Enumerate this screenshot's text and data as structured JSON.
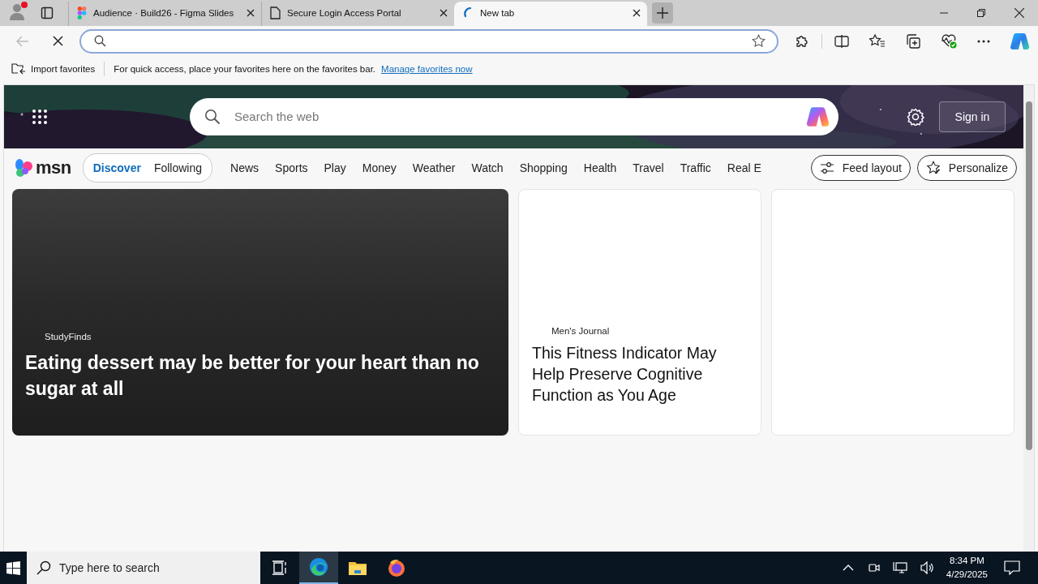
{
  "tabs": [
    {
      "title": "Audience · Build26 - Figma Slides",
      "selected": false
    },
    {
      "title": "Secure Login Access Portal",
      "selected": false
    },
    {
      "title": "New tab",
      "selected": true
    }
  ],
  "favorites_bar": {
    "import": "Import favorites",
    "message": "For quick access, place your favorites here on the favorites bar.",
    "link": "Manage favorites now"
  },
  "msn": {
    "search_placeholder": "Search the web",
    "sign_in": "Sign in",
    "logo": "msn",
    "feed_tabs": [
      {
        "label": "Discover",
        "selected": true
      },
      {
        "label": "Following",
        "selected": false
      }
    ],
    "nav": [
      "News",
      "Sports",
      "Play",
      "Money",
      "Weather",
      "Watch",
      "Shopping",
      "Health",
      "Travel",
      "Traffic",
      "Real E"
    ],
    "feed_layout": "Feed layout",
    "personalize": "Personalize"
  },
  "cards": [
    {
      "kind": "hero",
      "source": "StudyFinds",
      "headline": "Eating dessert may be better for your heart than no sugar at all"
    },
    {
      "kind": "article",
      "source": "Men's Journal",
      "headline": "This Fitness Indicator May Help Preserve Cognitive Function as You Age"
    },
    {
      "kind": "empty"
    }
  ],
  "taskbar": {
    "search_placeholder": "Type here to search",
    "apps": [
      {
        "selected": false
      },
      {
        "selected": true
      },
      {
        "selected": false
      },
      {
        "selected": false
      }
    ],
    "time": "8:34 PM",
    "date": "4/29/2025"
  }
}
